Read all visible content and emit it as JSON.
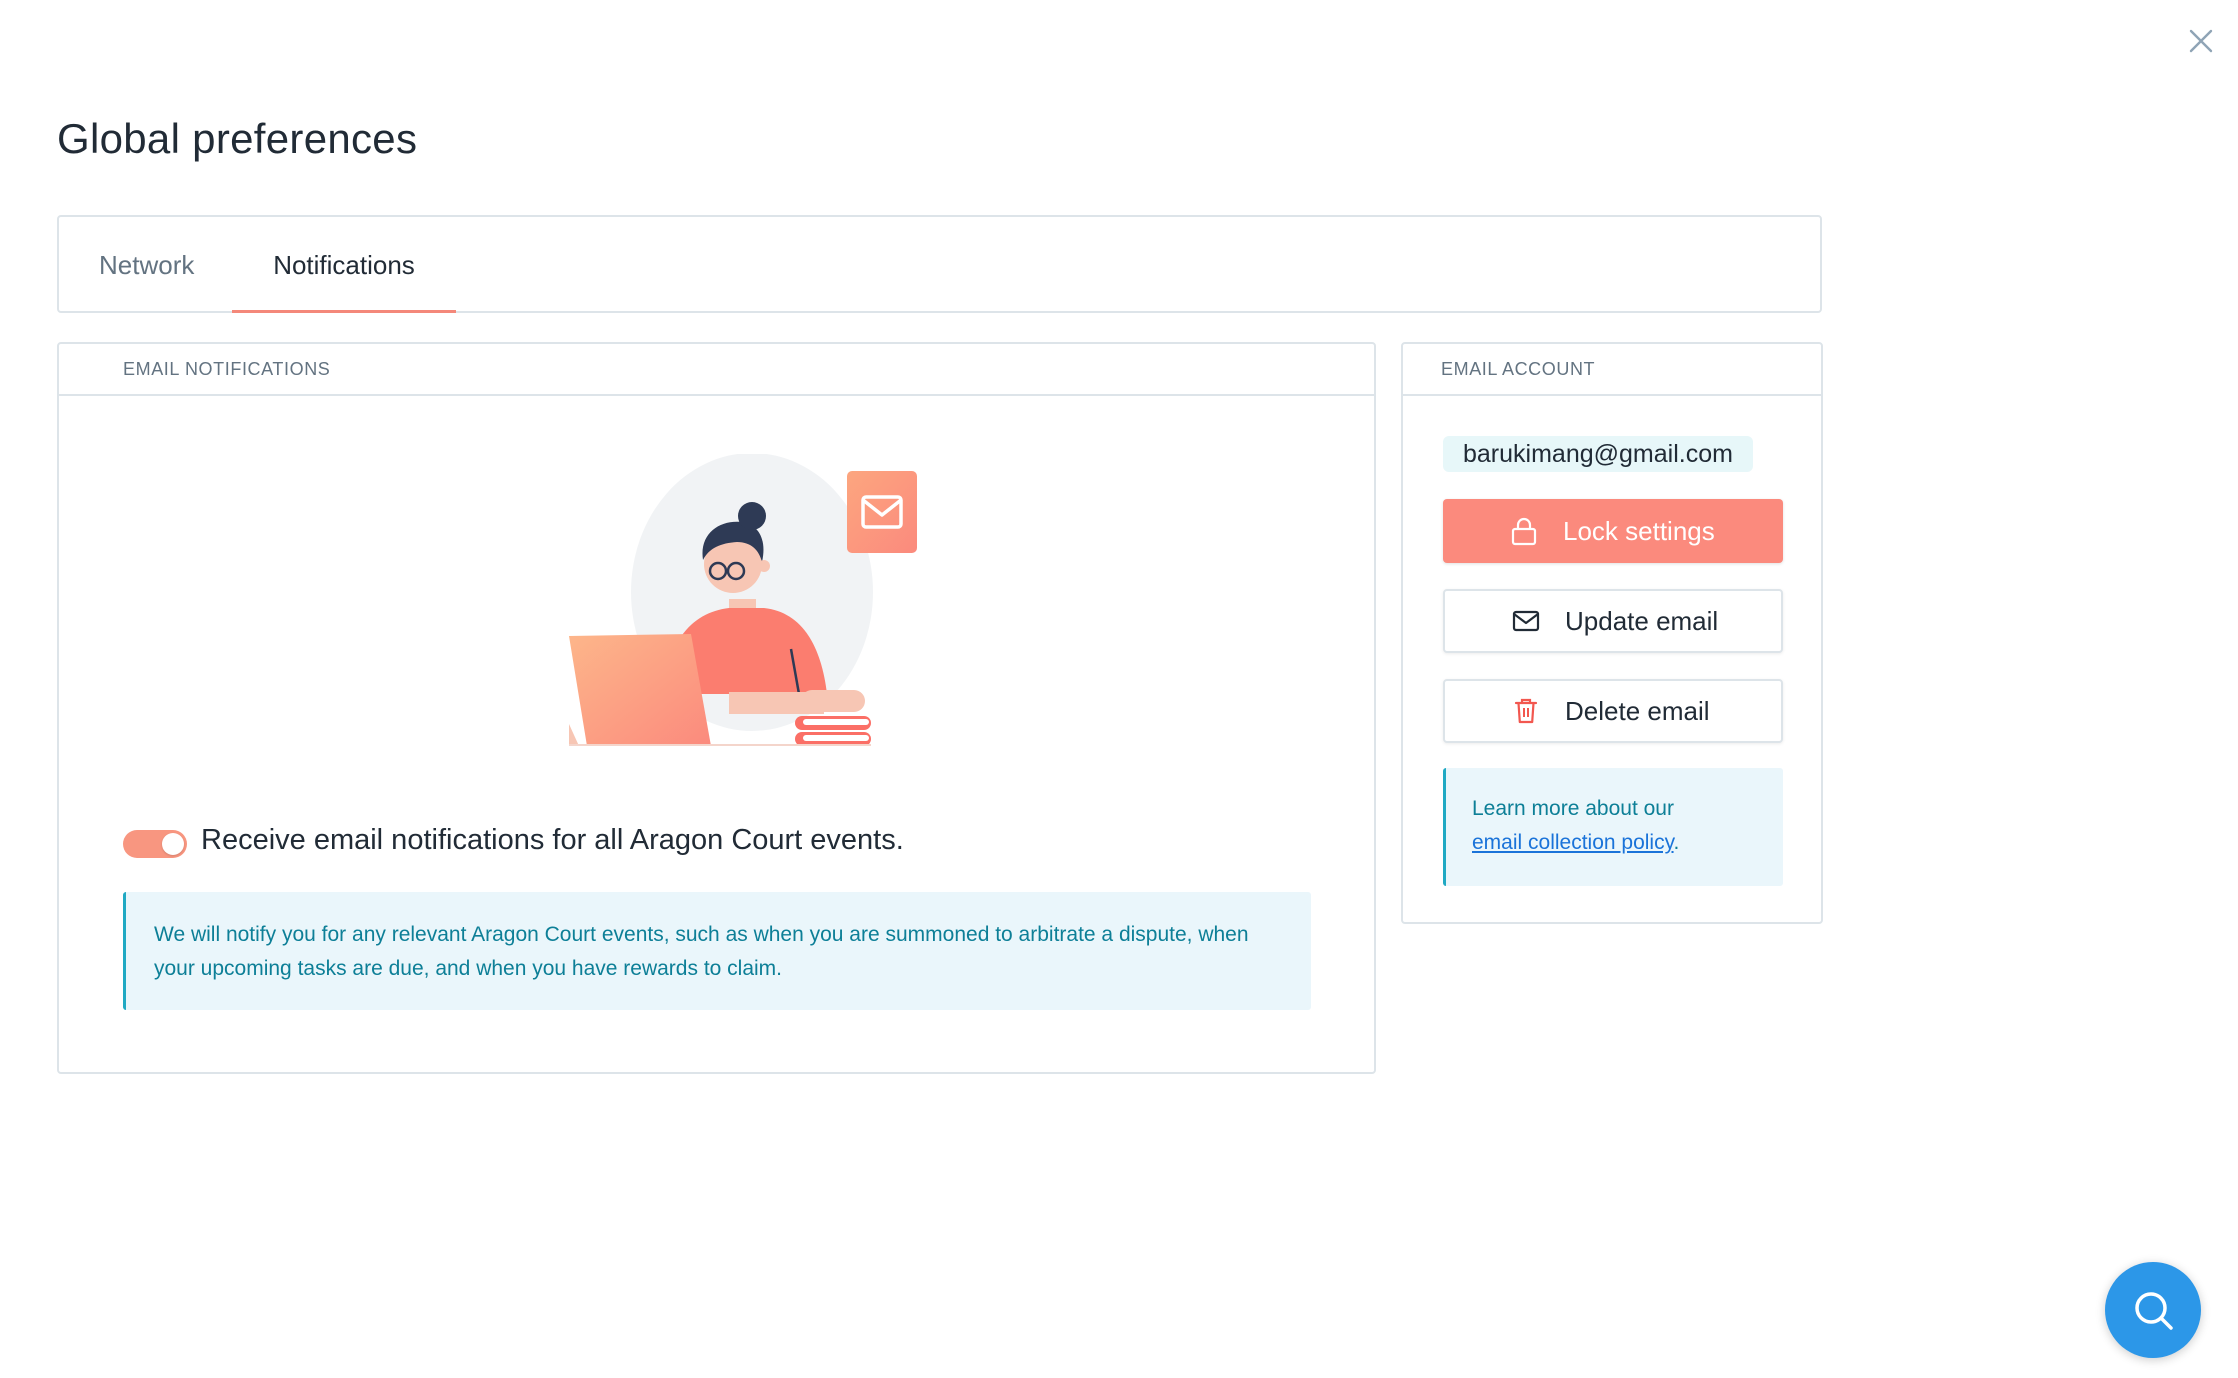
{
  "modal": {
    "title": "Global preferences"
  },
  "tabs": [
    {
      "label": "Network",
      "active": false
    },
    {
      "label": "Notifications",
      "active": true
    }
  ],
  "email_notifications": {
    "header": "EMAIL NOTIFICATIONS",
    "toggle_enabled": true,
    "toggle_label": "Receive email notifications for all Aragon Court events.",
    "info_text": "We will notify you for any relevant Aragon Court events, such as when you are summoned to arbitrate a dispute, when your upcoming tasks are due, and when you have rewards to claim."
  },
  "email_account": {
    "header": "EMAIL ACCOUNT",
    "email": "barukimang@gmail.com",
    "lock_label": "Lock settings",
    "update_label": "Update email",
    "delete_label": "Delete email",
    "policy_prefix": "Learn more about our",
    "policy_link": "email collection policy",
    "policy_suffix": "."
  },
  "icons": {
    "close": "close-icon",
    "lock": "lock-icon",
    "mail": "mail-icon",
    "trash": "trash-icon",
    "help": "search-help-icon"
  },
  "colors": {
    "accent": "#fb8a7d",
    "info_bg": "#eaf6fb",
    "info_text": "#0d7f97",
    "help_button": "#2c97e8"
  }
}
